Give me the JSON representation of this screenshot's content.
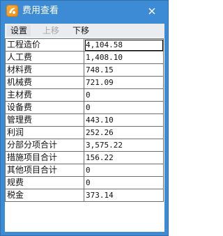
{
  "window": {
    "title": "费用查看"
  },
  "menu": {
    "items": [
      {
        "label": "设置",
        "state": "active"
      },
      {
        "label": "上移",
        "state": "disabled"
      },
      {
        "label": "下移",
        "state": "normal"
      }
    ]
  },
  "fees": [
    {
      "label": "工程造价",
      "value": "4,104.58"
    },
    {
      "label": "人工费",
      "value": "1,408.10"
    },
    {
      "label": "材料费",
      "value": "748.15"
    },
    {
      "label": "机械费",
      "value": "721.09"
    },
    {
      "label": "主材费",
      "value": "0"
    },
    {
      "label": "设备费",
      "value": "0"
    },
    {
      "label": "管理费",
      "value": "443.10"
    },
    {
      "label": "利润",
      "value": "252.26"
    },
    {
      "label": "分部分项合计",
      "value": "3,575.22"
    },
    {
      "label": "措施项目合计",
      "value": "156.22"
    },
    {
      "label": "其他项目合计",
      "value": "0"
    },
    {
      "label": "规费",
      "value": "0"
    },
    {
      "label": "税金",
      "value": "373.14"
    }
  ],
  "colors": {
    "titlebar": "#3d8bd4",
    "menubar": "#eaedf0",
    "grid_line": "#6f6f6f",
    "disabled_text": "#a7a7a7"
  }
}
